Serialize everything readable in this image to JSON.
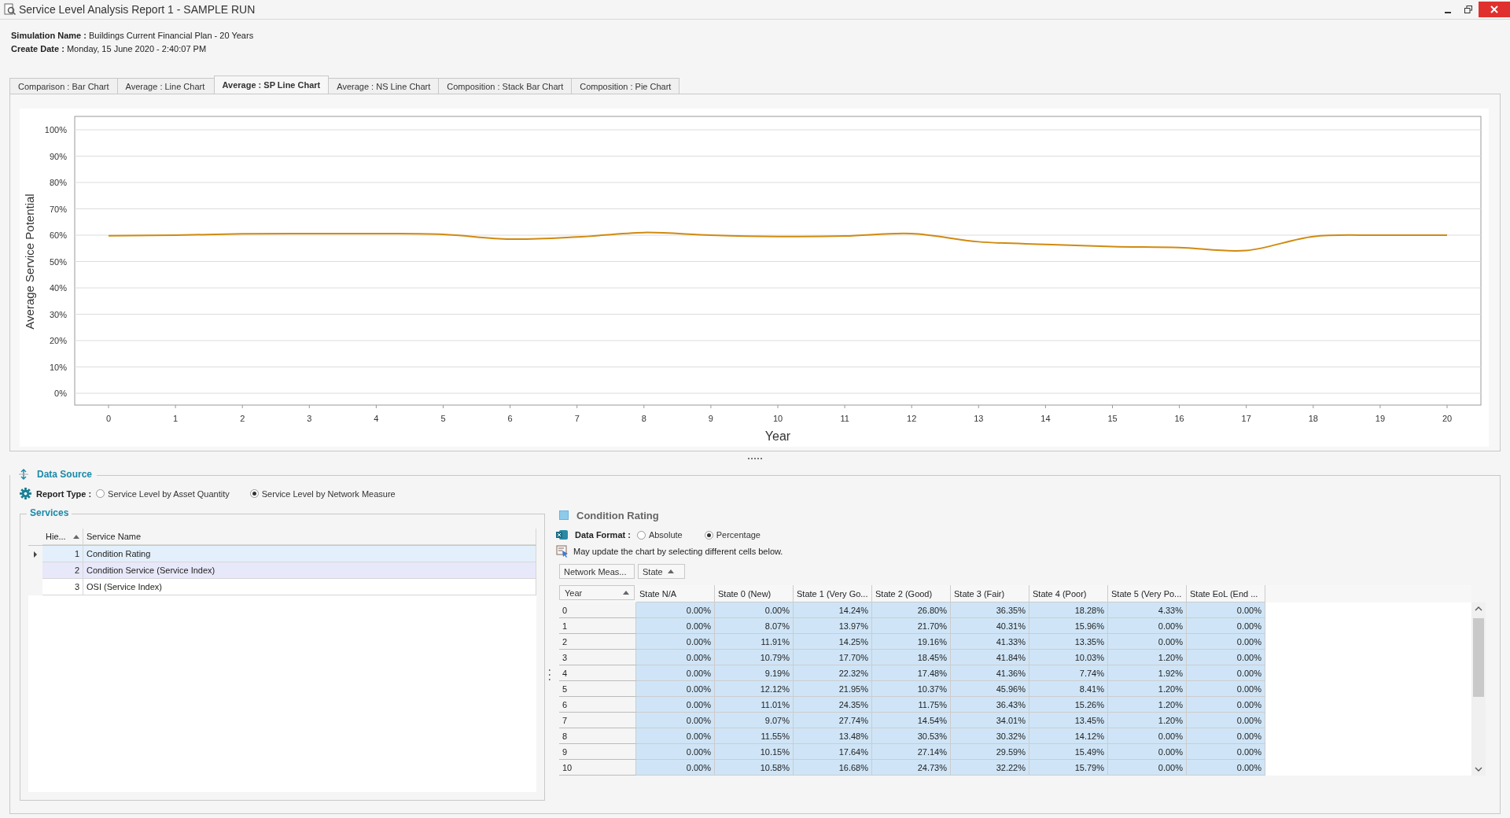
{
  "window": {
    "title": "Service Level Analysis Report 1 - SAMPLE RUN"
  },
  "header": {
    "simulation_name_label": "Simulation Name :",
    "simulation_name": "Buildings Current Financial Plan - 20 Years",
    "create_date_label": "Create Date :",
    "create_date": "Monday, 15 June 2020 - 2:40:07 PM"
  },
  "tabs": [
    {
      "label": "Comparison : Bar Chart",
      "selected": false
    },
    {
      "label": "Average : Line Chart",
      "selected": false
    },
    {
      "label": "Average : SP Line Chart",
      "selected": true
    },
    {
      "label": "Average : NS Line Chart",
      "selected": false
    },
    {
      "label": "Composition : Stack Bar Chart",
      "selected": false
    },
    {
      "label": "Composition : Pie Chart",
      "selected": false
    }
  ],
  "chart": {
    "chart_data": {
      "type": "line",
      "xlabel": "Year",
      "ylabel": "Average Service Potential",
      "categories": [
        "0",
        "1",
        "2",
        "3",
        "4",
        "5",
        "6",
        "7",
        "8",
        "9",
        "10",
        "11",
        "12",
        "13",
        "14",
        "15",
        "16",
        "17",
        "18",
        "19",
        "20"
      ],
      "grid": true,
      "series": [
        {
          "color": "#d08a10",
          "values": [
            59.8,
            60,
            60.5,
            60.6,
            60.6,
            60.3,
            58.5,
            59.3,
            61,
            60,
            59.5,
            59.7,
            60.6,
            57.5,
            56.5,
            55.7,
            55.3,
            54.2,
            59.5,
            60,
            60
          ]
        }
      ],
      "ylim": [
        0,
        100
      ],
      "yticks": [
        {
          "value": 0,
          "label": "0%"
        },
        {
          "value": 10,
          "label": "10%"
        },
        {
          "value": 20,
          "label": "20%"
        },
        {
          "value": 30,
          "label": "30%"
        },
        {
          "value": 40,
          "label": "40%"
        },
        {
          "value": 50,
          "label": "50%"
        },
        {
          "value": 60,
          "label": "60%"
        },
        {
          "value": 70,
          "label": "70%"
        },
        {
          "value": 80,
          "label": "80%"
        },
        {
          "value": 90,
          "label": "90%"
        },
        {
          "value": 100,
          "label": "100%"
        }
      ]
    }
  },
  "data_source": {
    "title": "Data Source",
    "report_type_label": "Report Type :",
    "report_type_options": [
      {
        "label": "Service Level by Asset Quantity",
        "selected": false
      },
      {
        "label": "Service Level by Network Measure",
        "selected": true
      }
    ],
    "services": {
      "title": "Services",
      "columns": [
        "Hie...",
        "Service Name"
      ],
      "rows": [
        {
          "index": "1",
          "name": "Condition Rating",
          "selected": true,
          "highlighted": false
        },
        {
          "index": "2",
          "name": "Condition Service (Service Index)",
          "selected": false,
          "highlighted": true
        },
        {
          "index": "3",
          "name": "OSI (Service Index)",
          "selected": false,
          "highlighted": false
        }
      ]
    }
  },
  "detail": {
    "title": "Condition Rating",
    "data_format_label": "Data Format :",
    "data_format_options": [
      {
        "label": "Absolute",
        "selected": false
      },
      {
        "label": "Percentage",
        "selected": true
      }
    ],
    "hint": "May update the chart by selecting different cells below.",
    "filter_fields": [
      "Network Meas...",
      "State"
    ],
    "row_header": "Year",
    "columns": [
      "State N/A",
      "State 0 (New)",
      "State 1 (Very Go...",
      "State 2 (Good)",
      "State 3 (Fair)",
      "State 4 (Poor)",
      "State 5 (Very Po...",
      "State EoL (End ..."
    ],
    "rows": [
      {
        "year": "0",
        "values": [
          "0.00%",
          "0.00%",
          "14.24%",
          "26.80%",
          "36.35%",
          "18.28%",
          "4.33%",
          "0.00%"
        ]
      },
      {
        "year": "1",
        "values": [
          "0.00%",
          "8.07%",
          "13.97%",
          "21.70%",
          "40.31%",
          "15.96%",
          "0.00%",
          "0.00%"
        ]
      },
      {
        "year": "2",
        "values": [
          "0.00%",
          "11.91%",
          "14.25%",
          "19.16%",
          "41.33%",
          "13.35%",
          "0.00%",
          "0.00%"
        ]
      },
      {
        "year": "3",
        "values": [
          "0.00%",
          "10.79%",
          "17.70%",
          "18.45%",
          "41.84%",
          "10.03%",
          "1.20%",
          "0.00%"
        ]
      },
      {
        "year": "4",
        "values": [
          "0.00%",
          "9.19%",
          "22.32%",
          "17.48%",
          "41.36%",
          "7.74%",
          "1.92%",
          "0.00%"
        ]
      },
      {
        "year": "5",
        "values": [
          "0.00%",
          "12.12%",
          "21.95%",
          "10.37%",
          "45.96%",
          "8.41%",
          "1.20%",
          "0.00%"
        ]
      },
      {
        "year": "6",
        "values": [
          "0.00%",
          "11.01%",
          "24.35%",
          "11.75%",
          "36.43%",
          "15.26%",
          "1.20%",
          "0.00%"
        ]
      },
      {
        "year": "7",
        "values": [
          "0.00%",
          "9.07%",
          "27.74%",
          "14.54%",
          "34.01%",
          "13.45%",
          "1.20%",
          "0.00%"
        ]
      },
      {
        "year": "8",
        "values": [
          "0.00%",
          "11.55%",
          "13.48%",
          "30.53%",
          "30.32%",
          "14.12%",
          "0.00%",
          "0.00%"
        ]
      },
      {
        "year": "9",
        "values": [
          "0.00%",
          "10.15%",
          "17.64%",
          "27.14%",
          "29.59%",
          "15.49%",
          "0.00%",
          "0.00%"
        ]
      },
      {
        "year": "10",
        "values": [
          "0.00%",
          "10.58%",
          "16.68%",
          "24.73%",
          "32.22%",
          "15.79%",
          "0.00%",
          "0.00%"
        ]
      }
    ]
  }
}
